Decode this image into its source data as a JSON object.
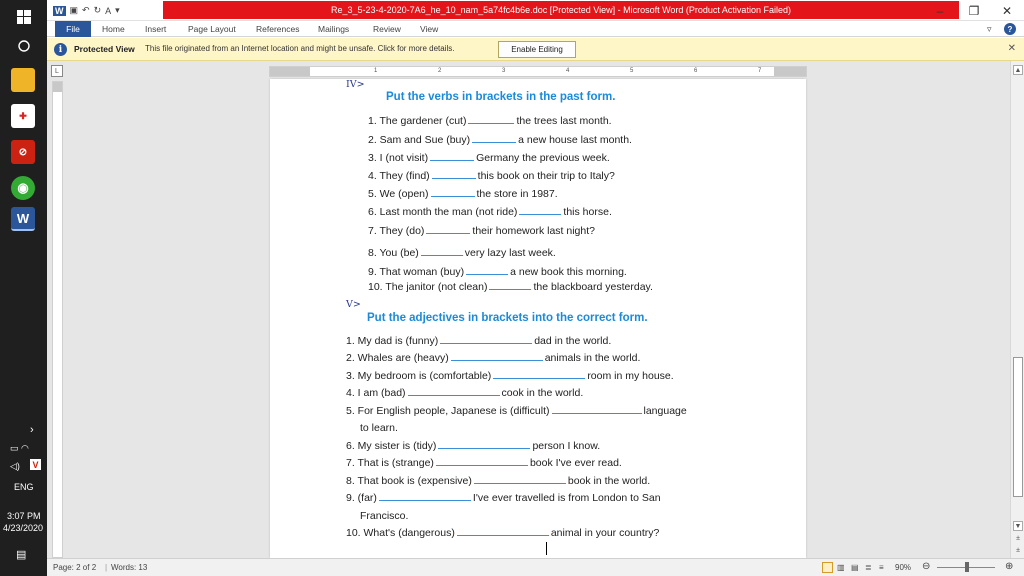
{
  "window": {
    "title": "Re_3_5-23-4-2020-7A6_he_10_nam_5a74fc4b6e.doc [Protected View] - Microsoft Word (Product Activation Failed)",
    "accent": "#2b579a",
    "title_bg": "#e3151a"
  },
  "ribbon": {
    "tabs": [
      "File",
      "Home",
      "Insert",
      "Page Layout",
      "References",
      "Mailings",
      "Review",
      "View"
    ]
  },
  "protected_view": {
    "title": "Protected View",
    "message": "This file originated from an Internet location and might be unsafe. Click for more details.",
    "button": "Enable Editing",
    "icon": "info-icon",
    "bg": "#fff6c8"
  },
  "taskbar": {
    "time": "3:07 PM",
    "date": "4/23/2020",
    "language": "ENG"
  },
  "ruler": {
    "labels": [
      "1",
      "2",
      "3",
      "4",
      "5",
      "6",
      "7"
    ]
  },
  "document": {
    "section4_mark": "IV>",
    "section4_heading": "Put the verbs in brackets in the past form.",
    "section4_items": [
      {
        "pre": "1.  The gardener (cut)",
        "post": "the trees last month."
      },
      {
        "pre": "2.  Sam and Sue (buy)",
        "post": "a new house last month."
      },
      {
        "pre": "3.  I (not visit)",
        "post": "Germany the previous week."
      },
      {
        "pre": "4.  They (find)",
        "post": "this book on their trip to Italy?"
      },
      {
        "pre": "5.  We (open)",
        "post": "the store in 1987."
      },
      {
        "pre": "6.  Last month the man (not ride)",
        "post": "this horse."
      },
      {
        "pre": "7.  They (do)",
        "post": "their homework last night?"
      },
      {
        "pre": "8.  You (be)",
        "post": "very lazy last week."
      },
      {
        "pre": "9.  That woman (buy)",
        "post": "a new book this morning."
      },
      {
        "pre": "10. The janitor (not clean)",
        "post": "the blackboard yesterday."
      }
    ],
    "section5_mark": "V>",
    "section5_heading": "Put the adjectives in brackets into the correct form.",
    "section5_items": [
      {
        "pre": "1. My dad is (funny)",
        "post": "dad in the world."
      },
      {
        "pre": "2. Whales are (heavy)",
        "post": "animals in the world."
      },
      {
        "pre": "3. My bedroom is (comfortable)",
        "post": "room in my house."
      },
      {
        "pre": "4. I am (bad)",
        "post": "cook in the world."
      },
      {
        "pre": "5. For English people, Japanese is (difficult)",
        "post": "language"
      },
      {
        "pre": "to learn.",
        "post": ""
      },
      {
        "pre": "6. My sister is (tidy)",
        "post": "person I know."
      },
      {
        "pre": "7. That is (strange)",
        "post": "book I've ever read."
      },
      {
        "pre": "8. That book is (expensive)",
        "post": "book in the world."
      },
      {
        "pre": "9. (far)",
        "post": "I've ever travelled is from London to San"
      },
      {
        "pre": "Francisco.",
        "post": ""
      },
      {
        "pre": "10. What's (dangerous)",
        "post": "animal in your country?"
      }
    ]
  },
  "status": {
    "page": "Page: 2 of 2",
    "words": "Words: 13",
    "zoom": "90%"
  }
}
